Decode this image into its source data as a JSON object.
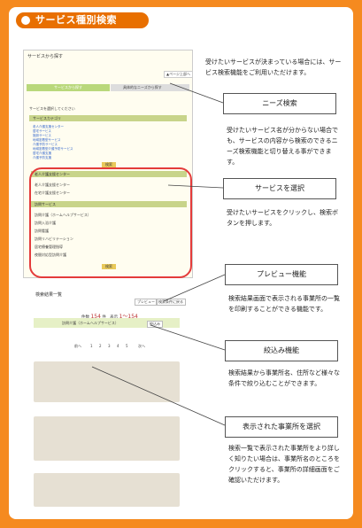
{
  "header": {
    "title": "サービス種別検索"
  },
  "shot1": {
    "title": "サービスから探す",
    "to_page_top": "▲ページ上部へ",
    "tab_service": "サービスから探す",
    "tab_needs": "具体的なニーズから探す",
    "intro": "サービスを選択してください",
    "category_label": "サービスカテゴリ",
    "category_links": [
      "老人介護支援センター",
      "居宅サービス",
      "施設サービス",
      "地域密着型サービス",
      "介護予防サービス",
      "地域密着型介護予防サービス",
      "居宅介護支援",
      "介護予防支援"
    ],
    "search_btn_top": "検索",
    "section_center": "老人介護支援センター",
    "center_row1": "老人介護支援センター",
    "center_row2": "在宅介護支援センター",
    "section_home": "訪問サービス",
    "home_rows": [
      "訪問介護（ホームヘルプサービス）",
      "訪問入浴介護",
      "訪問看護",
      "訪問リハビリテーション",
      "居宅療養管理指導",
      "夜間対応型訪問介護"
    ],
    "search_btn": "検索"
  },
  "descriptions": {
    "intro": "受けたいサービスが決まっている場合には、サービス検索機能をご利用いただけます。",
    "needs": "受けたいサービス名が分からない場合でも、サービスの内容から検索のできるニーズ検索機能と切り替える事ができます。",
    "select": "受けたいサービスをクリックし、検索ボタンを押します。",
    "preview": "検索結果画面で表示される事業所の一覧を印刷することができる機能です。",
    "filter": "検索結果から事業所名、住所など様々な条件で絞り込むことができます。",
    "office": "検索一覧で表示された事業所をより詳しく知りたい場合は、事業所名のところをクリックすると、事業所の詳細画面をご確認いただけます。"
  },
  "callouts": {
    "needs": "ニーズ検索",
    "select": "サービスを選択",
    "preview": "プレビュー機能",
    "filter": "絞込み機能",
    "office": "表示された事業所を選択"
  },
  "shot2": {
    "title": "検索結果一覧",
    "preview_btn": "プレビュー",
    "back_btn": "検索条件に戻る",
    "count_label": "件数",
    "count_value": "154",
    "count_unit": "件",
    "range_label": "表示",
    "range_value": "1～154",
    "condition": "訪問介護（ホームヘルプサービス）",
    "filter_btn": "絞込み",
    "pages": [
      "前へ",
      "1",
      "2",
      "3",
      "4",
      "5",
      "次へ"
    ]
  }
}
